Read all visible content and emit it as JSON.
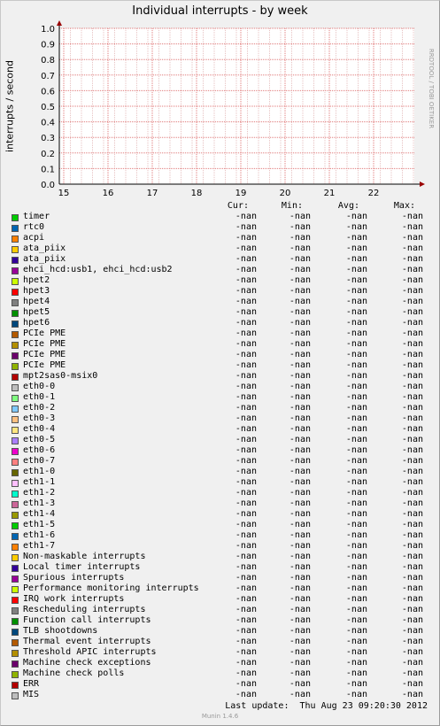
{
  "chart_data": {
    "type": "line",
    "title": "Individual interrupts - by week",
    "ylabel": "interrupts / second",
    "xlabel": "",
    "ylim": [
      0.0,
      1.0
    ],
    "yticks": [
      "0.0",
      "0.1",
      "0.2",
      "0.3",
      "0.4",
      "0.5",
      "0.6",
      "0.7",
      "0.8",
      "0.9",
      "1.0"
    ],
    "xticks": [
      "15",
      "16",
      "17",
      "18",
      "19",
      "20",
      "21",
      "22"
    ],
    "grid": true,
    "series": []
  },
  "watermark": "RRDTOOL / TOBI OETIKER",
  "legend_headers": {
    "cur": "Cur:",
    "min": "Min:",
    "avg": "Avg:",
    "max": "Max:"
  },
  "legend": [
    {
      "name": "timer",
      "color": "#00cc00",
      "cur": "-nan",
      "min": "-nan",
      "avg": "-nan",
      "max": "-nan"
    },
    {
      "name": "rtc0",
      "color": "#0066b3",
      "cur": "-nan",
      "min": "-nan",
      "avg": "-nan",
      "max": "-nan"
    },
    {
      "name": "acpi",
      "color": "#ff8000",
      "cur": "-nan",
      "min": "-nan",
      "avg": "-nan",
      "max": "-nan"
    },
    {
      "name": "ata_piix",
      "color": "#ffcc00",
      "cur": "-nan",
      "min": "-nan",
      "avg": "-nan",
      "max": "-nan"
    },
    {
      "name": "ata_piix",
      "color": "#330099",
      "cur": "-nan",
      "min": "-nan",
      "avg": "-nan",
      "max": "-nan"
    },
    {
      "name": "ehci_hcd:usb1, ehci_hcd:usb2",
      "color": "#990099",
      "cur": "-nan",
      "min": "-nan",
      "avg": "-nan",
      "max": "-nan"
    },
    {
      "name": "hpet2",
      "color": "#ccff00",
      "cur": "-nan",
      "min": "-nan",
      "avg": "-nan",
      "max": "-nan"
    },
    {
      "name": "hpet3",
      "color": "#ff0000",
      "cur": "-nan",
      "min": "-nan",
      "avg": "-nan",
      "max": "-nan"
    },
    {
      "name": "hpet4",
      "color": "#808080",
      "cur": "-nan",
      "min": "-nan",
      "avg": "-nan",
      "max": "-nan"
    },
    {
      "name": "hpet5",
      "color": "#008f00",
      "cur": "-nan",
      "min": "-nan",
      "avg": "-nan",
      "max": "-nan"
    },
    {
      "name": "hpet6",
      "color": "#00487d",
      "cur": "-nan",
      "min": "-nan",
      "avg": "-nan",
      "max": "-nan"
    },
    {
      "name": "PCIe PME",
      "color": "#b35a00",
      "cur": "-nan",
      "min": "-nan",
      "avg": "-nan",
      "max": "-nan"
    },
    {
      "name": "PCIe PME",
      "color": "#b38f00",
      "cur": "-nan",
      "min": "-nan",
      "avg": "-nan",
      "max": "-nan"
    },
    {
      "name": "PCIe PME",
      "color": "#6b006b",
      "cur": "-nan",
      "min": "-nan",
      "avg": "-nan",
      "max": "-nan"
    },
    {
      "name": "PCIe PME",
      "color": "#8fb300",
      "cur": "-nan",
      "min": "-nan",
      "avg": "-nan",
      "max": "-nan"
    },
    {
      "name": "mpt2sas0-msix0",
      "color": "#b30000",
      "cur": "-nan",
      "min": "-nan",
      "avg": "-nan",
      "max": "-nan"
    },
    {
      "name": "eth0-0",
      "color": "#bebebe",
      "cur": "-nan",
      "min": "-nan",
      "avg": "-nan",
      "max": "-nan"
    },
    {
      "name": "eth0-1",
      "color": "#80ff80",
      "cur": "-nan",
      "min": "-nan",
      "avg": "-nan",
      "max": "-nan"
    },
    {
      "name": "eth0-2",
      "color": "#80c9ff",
      "cur": "-nan",
      "min": "-nan",
      "avg": "-nan",
      "max": "-nan"
    },
    {
      "name": "eth0-3",
      "color": "#ffc080",
      "cur": "-nan",
      "min": "-nan",
      "avg": "-nan",
      "max": "-nan"
    },
    {
      "name": "eth0-4",
      "color": "#ffe680",
      "cur": "-nan",
      "min": "-nan",
      "avg": "-nan",
      "max": "-nan"
    },
    {
      "name": "eth0-5",
      "color": "#aa80ff",
      "cur": "-nan",
      "min": "-nan",
      "avg": "-nan",
      "max": "-nan"
    },
    {
      "name": "eth0-6",
      "color": "#ee00cc",
      "cur": "-nan",
      "min": "-nan",
      "avg": "-nan",
      "max": "-nan"
    },
    {
      "name": "eth0-7",
      "color": "#ff8080",
      "cur": "-nan",
      "min": "-nan",
      "avg": "-nan",
      "max": "-nan"
    },
    {
      "name": "eth1-0",
      "color": "#666600",
      "cur": "-nan",
      "min": "-nan",
      "avg": "-nan",
      "max": "-nan"
    },
    {
      "name": "eth1-1",
      "color": "#ffbfff",
      "cur": "-nan",
      "min": "-nan",
      "avg": "-nan",
      "max": "-nan"
    },
    {
      "name": "eth1-2",
      "color": "#00ffcc",
      "cur": "-nan",
      "min": "-nan",
      "avg": "-nan",
      "max": "-nan"
    },
    {
      "name": "eth1-3",
      "color": "#cc6699",
      "cur": "-nan",
      "min": "-nan",
      "avg": "-nan",
      "max": "-nan"
    },
    {
      "name": "eth1-4",
      "color": "#999900",
      "cur": "-nan",
      "min": "-nan",
      "avg": "-nan",
      "max": "-nan"
    },
    {
      "name": "eth1-5",
      "color": "#00cc00",
      "cur": "-nan",
      "min": "-nan",
      "avg": "-nan",
      "max": "-nan"
    },
    {
      "name": "eth1-6",
      "color": "#0066b3",
      "cur": "-nan",
      "min": "-nan",
      "avg": "-nan",
      "max": "-nan"
    },
    {
      "name": "eth1-7",
      "color": "#ff8000",
      "cur": "-nan",
      "min": "-nan",
      "avg": "-nan",
      "max": "-nan"
    },
    {
      "name": "Non-maskable interrupts",
      "color": "#ffcc00",
      "cur": "-nan",
      "min": "-nan",
      "avg": "-nan",
      "max": "-nan"
    },
    {
      "name": "Local timer interrupts",
      "color": "#330099",
      "cur": "-nan",
      "min": "-nan",
      "avg": "-nan",
      "max": "-nan"
    },
    {
      "name": "Spurious interrupts",
      "color": "#990099",
      "cur": "-nan",
      "min": "-nan",
      "avg": "-nan",
      "max": "-nan"
    },
    {
      "name": "Performance monitoring interrupts",
      "color": "#ccff00",
      "cur": "-nan",
      "min": "-nan",
      "avg": "-nan",
      "max": "-nan"
    },
    {
      "name": "IRQ work interrupts",
      "color": "#ff0000",
      "cur": "-nan",
      "min": "-nan",
      "avg": "-nan",
      "max": "-nan"
    },
    {
      "name": "Rescheduling interrupts",
      "color": "#808080",
      "cur": "-nan",
      "min": "-nan",
      "avg": "-nan",
      "max": "-nan"
    },
    {
      "name": "Function call interrupts",
      "color": "#008f00",
      "cur": "-nan",
      "min": "-nan",
      "avg": "-nan",
      "max": "-nan"
    },
    {
      "name": "TLB shootdowns",
      "color": "#00487d",
      "cur": "-nan",
      "min": "-nan",
      "avg": "-nan",
      "max": "-nan"
    },
    {
      "name": "Thermal event interrupts",
      "color": "#b35a00",
      "cur": "-nan",
      "min": "-nan",
      "avg": "-nan",
      "max": "-nan"
    },
    {
      "name": "Threshold APIC interrupts",
      "color": "#b38f00",
      "cur": "-nan",
      "min": "-nan",
      "avg": "-nan",
      "max": "-nan"
    },
    {
      "name": "Machine check exceptions",
      "color": "#6b006b",
      "cur": "-nan",
      "min": "-nan",
      "avg": "-nan",
      "max": "-nan"
    },
    {
      "name": "Machine check polls",
      "color": "#8fb300",
      "cur": "-nan",
      "min": "-nan",
      "avg": "-nan",
      "max": "-nan"
    },
    {
      "name": "ERR",
      "color": "#b30000",
      "cur": "-nan",
      "min": "-nan",
      "avg": "-nan",
      "max": "-nan"
    },
    {
      "name": "MIS",
      "color": "#bebebe",
      "cur": "-nan",
      "min": "-nan",
      "avg": "-nan",
      "max": "-nan"
    }
  ],
  "last_update": "Last update:  Thu Aug 23 09:20:30 2012",
  "footer": "Munin 1.4.6"
}
